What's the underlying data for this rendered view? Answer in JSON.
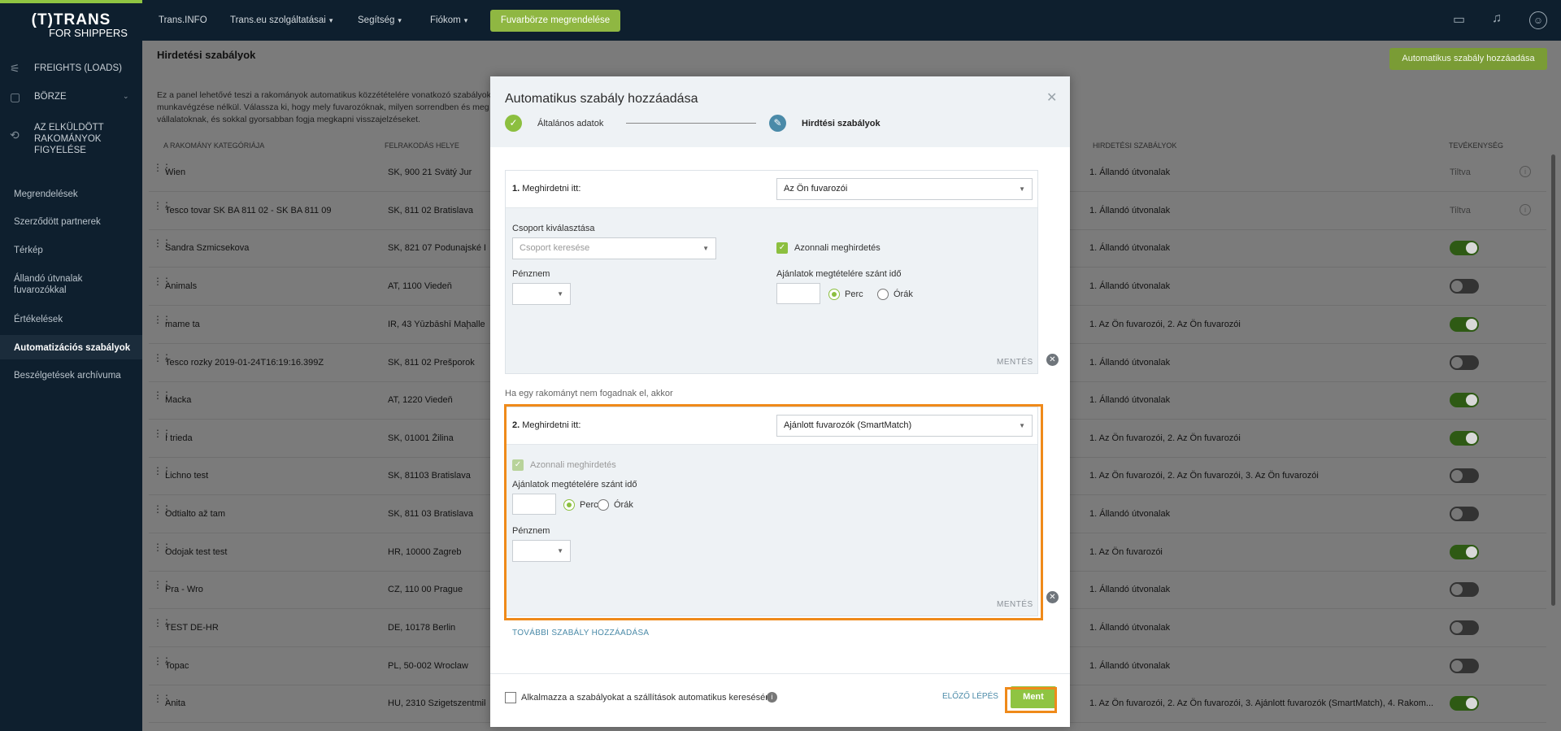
{
  "brand": {
    "line1": "(T)TRANS",
    "line2": "FOR SHIPPERS",
    "accent": "#8fc442"
  },
  "sidebar": {
    "top_items": [
      {
        "label": "FREIGHTS (LOADS)",
        "icon": "freight-icon"
      },
      {
        "label": "BÖRZE",
        "icon": "box-icon"
      },
      {
        "label": "AZ ELKÜLDÖTT RAKOMÁNYOK FIGYELÉSE",
        "icon": "monitor-icon"
      }
    ],
    "items": [
      {
        "label": "Megrendelések"
      },
      {
        "label": "Szerződött partnerek"
      },
      {
        "label": "Térkép"
      },
      {
        "label": "Állandó útvnalak fuvarozókkal"
      },
      {
        "label": "Értékelések"
      },
      {
        "label": "Automatizációs szabályok"
      },
      {
        "label": "Beszélgetések archívuma"
      }
    ]
  },
  "topbar": {
    "nav": [
      "Trans.INFO",
      "Trans.eu szolgáltatásai",
      "Segítség",
      "Fiókom"
    ],
    "order_button": "Fuvarbörze megrendelése"
  },
  "page": {
    "title": "Hirdetési szabályok",
    "add_button": "Automatikus szabály hozzáadása",
    "description": "Ez a panel lehetővé teszi a rakományok automatikus közzétételére vonatkozó szabályok munkavégzése nélkül. Válassza ki, hogy mely fuvarozóknak, milyen sorrendben és meg vállalatoknak, és sokkal gyorsabban fogja megkapni visszajelzéseket.",
    "columns": [
      "A RAKOMÁNY KATEGÓRIÁJA",
      "FELRAKODÁS HELYE",
      "HIRDETÉSI SZABÁLYOK",
      "TEVÉKENYSÉG"
    ],
    "rows": [
      {
        "name": "Wien",
        "place": "SK, 900 21 Svätý Jur",
        "rules": "1. Állandó útvonalak",
        "status": "Tiltva"
      },
      {
        "name": "Tesco tovar SK BA 811 02 - SK BA 811 09",
        "place": "SK, 811 02 Bratislava",
        "rules": "1. Állandó útvonalak",
        "status": "Tiltva"
      },
      {
        "name": "Sandra Szmicsekova",
        "place": "SK, 821 07 Podunajské Bis",
        "rules": "1. Állandó útvonalak",
        "toggle": "on"
      },
      {
        "name": "Animals",
        "place": "AT, 1100 Viedeň",
        "rules": "1. Állandó útvonalak",
        "toggle": "off"
      },
      {
        "name": "mame ta",
        "place": "IR, 43 Yūzbāshī Maḩalleh",
        "rules": "1. Az Ön fuvarozói, 2. Az Ön fuvarozói",
        "toggle": "on"
      },
      {
        "name": "Tesco rozky 2019-01-24T16:19:16.399Z",
        "place": "SK, 811 02 Prešporok",
        "rules": "1. Állandó útvonalak",
        "toggle": "off"
      },
      {
        "name": "Macka",
        "place": "AT, 1220 Viedeň",
        "rules": "1. Állandó útvonalak",
        "toggle": "on"
      },
      {
        "name": "I trieda",
        "place": "SK, 01001 Žilina",
        "rules": "1. Az Ön fuvarozói, 2. Az Ön fuvarozói",
        "toggle": "on"
      },
      {
        "name": "Lichno test",
        "place": "SK, 81103 Bratislava",
        "rules": "1. Az Ön fuvarozói, 2. Az Ön fuvarozói, 3. Az Ön fuvarozói",
        "toggle": "off"
      },
      {
        "name": "Odtialto až tam",
        "place": "SK, 811 03 Bratislava",
        "rules": "1. Állandó útvonalak",
        "toggle": "off"
      },
      {
        "name": "Odojak test test",
        "place": "HR, 10000 Zagreb",
        "rules": "1. Az Ön fuvarozói",
        "toggle": "on"
      },
      {
        "name": "Pra - Wro",
        "place": "CZ, 110 00 Prague",
        "rules": "1. Állandó útvonalak",
        "toggle": "off"
      },
      {
        "name": "TEST DE-HR",
        "place": "DE, 10178 Berlin",
        "rules": "1. Állandó útvonalak",
        "toggle": "off"
      },
      {
        "name": "Topac",
        "place": "PL, 50-002 Wroclaw",
        "rules": "1. Állandó útvonalak",
        "toggle": "off"
      },
      {
        "name": "Anita",
        "place": "HU, 2310 Szigetszentmikló",
        "rules": "1. Az Ön fuvarozói, 2. Az Ön fuvarozói, 3. Ajánlott fuvarozók (SmartMatch), 4. Rakom...",
        "toggle": "on"
      }
    ]
  },
  "modal": {
    "title": "Automatikus szabály hozzáadása",
    "step1": "Általános adatok",
    "step2": "Hirdtési szabályok",
    "rule1": {
      "num": "1.",
      "label": "Meghirdetni itt:",
      "select": "Az Ön fuvarozói",
      "group_label": "Csoport kiválasztása",
      "group_placeholder": "Csoport keresése",
      "immediate": "Azonnali meghirdetés",
      "currency": "Pénznem",
      "offer_time": "Ajánlatok megtételére szánt idő",
      "minutes": "Perc",
      "hours": "Órák",
      "save": "MENTÉS"
    },
    "between": "Ha egy rakományt nem fogadnak el, akkor",
    "rule2": {
      "num": "2.",
      "label": "Meghirdetni itt:",
      "select": "Ajánlott fuvarozók (SmartMatch)",
      "immediate": "Azonnali meghirdetés",
      "offer_time": "Ajánlatok megtételére szánt idő",
      "minutes": "Perc",
      "hours": "Órák",
      "currency": "Pénznem",
      "save": "MENTÉS"
    },
    "add_more": "TOVÁBBI SZABÁLY HOZZÁADÁSA",
    "apply_label": "Alkalmazza a szabályokat a szállítások automatikus keresésére",
    "prev": "ELŐZŐ LÉPÉS",
    "save": "Ment"
  }
}
